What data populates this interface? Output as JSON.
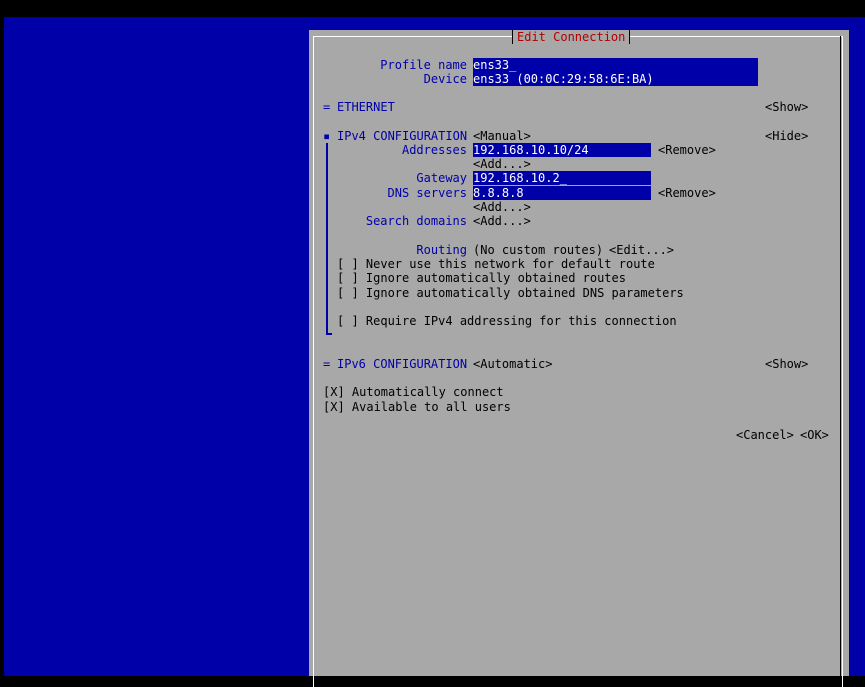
{
  "dialog": {
    "title": "Edit Connection"
  },
  "profile": {
    "profile_name_label": "Profile name",
    "profile_name_value": "ens33_",
    "device_label": "Device",
    "device_value": "ens33 (00:0C:29:58:6E:BA)"
  },
  "ethernet": {
    "marker": "=",
    "label": "ETHERNET",
    "toggle": "<Show>"
  },
  "ipv4": {
    "marker": "▪",
    "label": "IPv4 CONFIGURATION",
    "method": "<Manual>",
    "toggle": "<Hide>",
    "addresses_label": "Addresses",
    "address_value": "192.168.10.10/24",
    "address_remove": "<Remove>",
    "address_add": "<Add...>",
    "gateway_label": "Gateway",
    "gateway_value": "192.168.10.2_",
    "dns_label": "DNS servers",
    "dns_value": "8.8.8.8",
    "dns_remove": "<Remove>",
    "dns_add": "<Add...>",
    "search_label": "Search domains",
    "search_add": "<Add...>",
    "routing_label": "Routing",
    "routing_value": "(No custom routes)",
    "routing_edit": "<Edit...>",
    "checkbox_never_default": "[ ] Never use this network for default route",
    "checkbox_ignore_routes": "[ ] Ignore automatically obtained routes",
    "checkbox_ignore_dns": "[ ] Ignore automatically obtained DNS parameters",
    "checkbox_require_ipv4": "[ ] Require IPv4 addressing for this connection"
  },
  "ipv6": {
    "marker": "=",
    "label": "IPv6 CONFIGURATION",
    "method": "<Automatic>",
    "toggle": "<Show>"
  },
  "options": {
    "auto_connect": "[X] Automatically connect",
    "all_users": "[X] Available to all users"
  },
  "buttons": {
    "cancel": "<Cancel>",
    "ok": "<OK>"
  },
  "colors": {
    "background": "#0000a8",
    "dialog": "#a8a8a8",
    "title": "#b00000",
    "field": "#0000a8",
    "field_text": "#ffffff"
  }
}
